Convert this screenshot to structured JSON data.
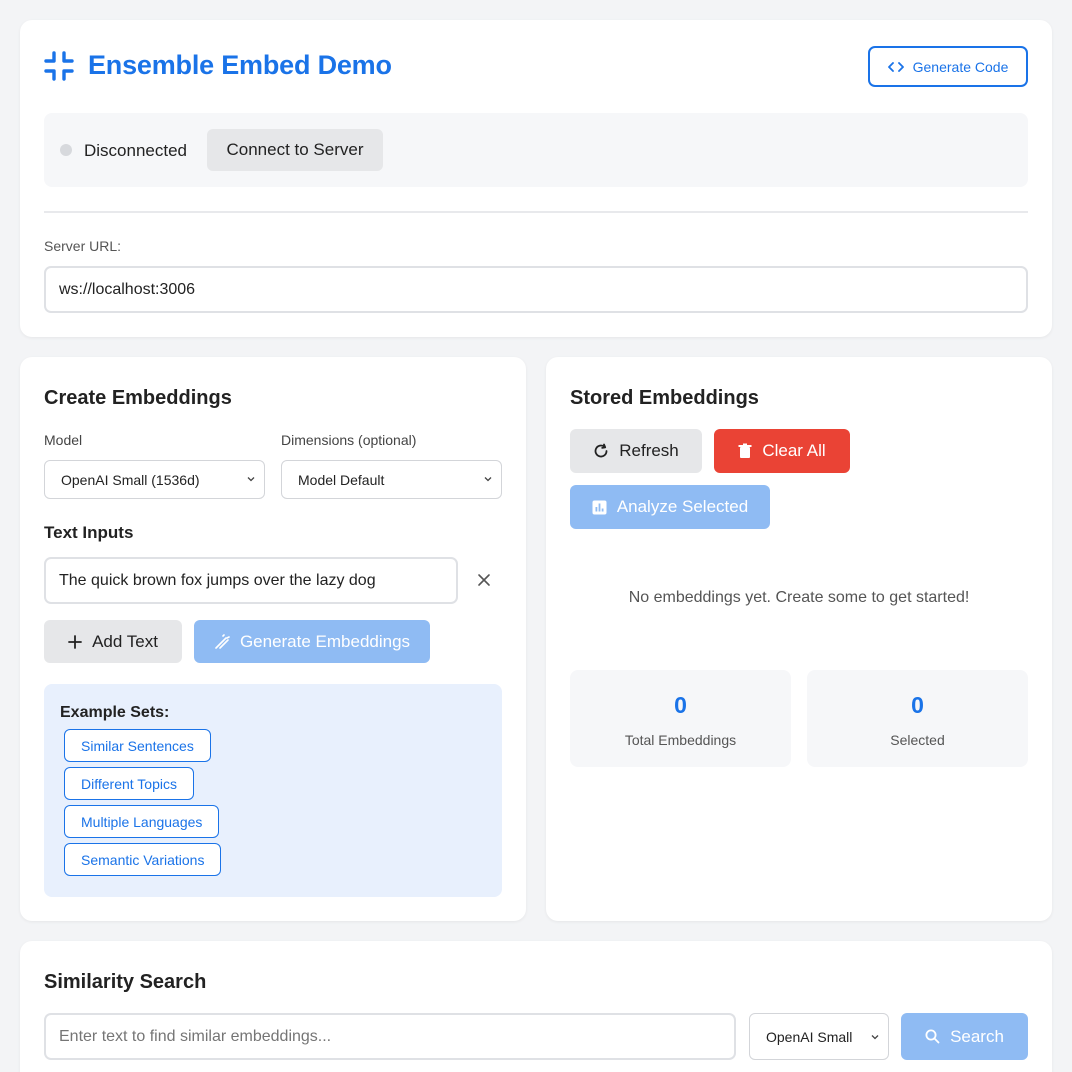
{
  "header": {
    "title": "Ensemble Embed Demo",
    "generate_code_label": "Generate Code",
    "status_text": "Disconnected",
    "connect_label": "Connect to Server",
    "server_url_label": "Server URL:",
    "server_url_value": "ws://localhost:3006"
  },
  "create": {
    "title": "Create Embeddings",
    "model_label": "Model",
    "model_value": "OpenAI Small (1536d)",
    "dimensions_label": "Dimensions (optional)",
    "dimensions_value": "Model Default",
    "text_inputs_label": "Text Inputs",
    "text_input_value": "The quick brown fox jumps over the lazy dog",
    "add_text_label": "Add Text",
    "generate_label": "Generate Embeddings",
    "examples_title": "Example Sets:",
    "examples": [
      "Similar Sentences",
      "Different Topics",
      "Multiple Languages",
      "Semantic Variations"
    ]
  },
  "stored": {
    "title": "Stored Embeddings",
    "refresh_label": "Refresh",
    "clear_label": "Clear All",
    "analyze_label": "Analyze Selected",
    "empty_message": "No embeddings yet. Create some to get started!",
    "total_value": "0",
    "total_label": "Total Embeddings",
    "selected_value": "0",
    "selected_label": "Selected"
  },
  "search": {
    "title": "Similarity Search",
    "placeholder": "Enter text to find similar embeddings...",
    "model_value": "OpenAI Small",
    "search_label": "Search"
  },
  "colors": {
    "accent": "#1a73e8",
    "danger": "#ea4335",
    "disabled_blue": "#8fbbf3"
  }
}
